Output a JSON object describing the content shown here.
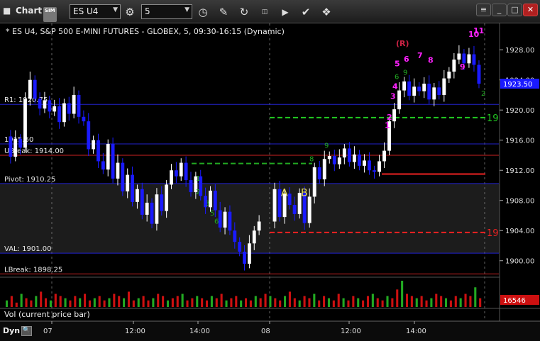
{
  "app": {
    "title": "Chart",
    "sim_badge": "SIM",
    "icon": "chart-icon"
  },
  "toolbar": {
    "symbol": "ES U4",
    "interval": "5",
    "icons": [
      "settings-gear-icon",
      "clock-icon",
      "pencil-draw-icon",
      "refresh-icon",
      "get-data-icon",
      "play-icon",
      "check-icon",
      "tools-icon"
    ],
    "window_buttons": [
      "menu-icon",
      "minimize-icon",
      "maximize-icon",
      "close-icon"
    ]
  },
  "chart_title": "* ES U4, S&P 500 E-MINI FUTURES - GLOBEX, 5, 09:30-16:15 (Dynamic)",
  "volume_label": "Vol (current price bar)",
  "bottom_left": {
    "mode": "Dyn",
    "mag_icon": "zoom-icon"
  },
  "colors": {
    "background": "#000000",
    "up_bar": "#ffffff",
    "down_bar": "#1a1aff",
    "pivot_line": "#2222cc",
    "break_line": "#cc2222",
    "green_dashed": "#22cc22",
    "red_dashed": "#ee2222",
    "value_area_fill": "#1c1c1c",
    "volume": "#cc1010",
    "price_tag": "#1a1aff",
    "volume_tag": "#cc1010",
    "sequential_magenta": "#ff22ff",
    "sequential_green": "#22aa22"
  },
  "chart_data": {
    "type": "candlestick",
    "yaxis": {
      "ticks": [
        "1928.00",
        "1924.00",
        "1920.00",
        "1916.00",
        "1912.00",
        "1908.00",
        "1904.00",
        "1900.00"
      ],
      "range": [
        1898,
        1931.5
      ]
    },
    "xaxis": {
      "ticks": [
        "07",
        "12:00",
        "14:00",
        "08",
        "12:00",
        "14:00"
      ]
    },
    "last_price": "1923.50",
    "last_volume": "16546",
    "levels": [
      {
        "label": "R1: 1920.75",
        "value": 1920.75,
        "color": "#2222cc"
      },
      {
        "label": "1915.50",
        "value": 1915.5,
        "color": "#2222cc"
      },
      {
        "label": "UBreak: 1914.00",
        "value": 1914.0,
        "color": "#cc2222"
      },
      {
        "label": "Pivot: 1910.25",
        "value": 1910.25,
        "color": "#2222cc"
      },
      {
        "label": "VAL: 1901.00",
        "value": 1901.0,
        "color": "#2222cc"
      },
      {
        "label": "LBreak: 1898.25",
        "value": 1898.25,
        "color": "#cc2222"
      }
    ],
    "dashed_levels": [
      {
        "value": 1919.0,
        "label": "19",
        "color": "#22cc22"
      },
      {
        "value": 1903.75,
        "label": "19",
        "color": "#ee2222"
      },
      {
        "value": 1912.9,
        "label": "",
        "color": "#22aa22"
      }
    ],
    "annotations": [
      "A",
      "B"
    ],
    "sequential_top_labels": [
      "(R)",
      "5",
      "6",
      "7",
      "8",
      "9",
      "10",
      "11",
      "4",
      "3",
      "2",
      "1"
    ],
    "sequential_green_labels": [
      "6",
      "9",
      "2",
      "1",
      "2",
      "3",
      "5",
      "6",
      "8",
      "9"
    ],
    "bars_day1": [
      1916.5,
      1913.8,
      1916.2,
      1915.0,
      1921.5,
      1924.0,
      1921.5,
      1920.2,
      1921.3,
      1919.8,
      1920.5,
      1918.4,
      1920.9,
      1919.5,
      1922.0,
      1919.1,
      1918.5,
      1914.8,
      1916.0,
      1913.2,
      1912.1,
      1915.5,
      1910.9,
      1913.0,
      1909.2,
      1911.4,
      1907.8,
      1909.5,
      1906.1,
      1907.7,
      1904.9,
      1908.8,
      1906.6,
      1910.1,
      1912.0,
      1911.2,
      1913.0,
      1910.7,
      1909.1,
      1911.2,
      1908.6,
      1907.1,
      1909.3,
      1906.7,
      1904.4,
      1906.5,
      1904.0,
      1902.5,
      1901.2,
      1899.6,
      1902.3,
      1904.0,
      1905.2
    ],
    "bars_day2": [
      1905.2,
      1909.5,
      1905.8,
      1908.9,
      1907.4,
      1906.2,
      1909.0,
      1905.0,
      1908.5,
      1912.4,
      1910.8,
      1913.5,
      1913.9,
      1912.8,
      1913.7,
      1914.9,
      1913.1,
      1914.1,
      1912.6,
      1913.3,
      1912.0,
      1911.8,
      1913.2,
      1914.6,
      1918.5,
      1920.1,
      1922.6,
      1923.8,
      1921.9,
      1923.1,
      1922.5,
      1923.5,
      1921.4,
      1923.0,
      1922.0,
      1924.2,
      1925.1,
      1926.7,
      1927.5,
      1926.2,
      1927.4,
      1926.0,
      1923.5
    ],
    "volume_series": [
      3,
      5,
      2,
      6,
      4,
      3,
      5,
      7,
      4,
      3,
      6,
      5,
      4,
      3,
      5,
      4,
      6,
      3,
      4,
      5,
      3,
      4,
      6,
      5,
      4,
      7,
      3,
      4,
      5,
      3,
      4,
      6,
      5,
      3,
      4,
      5,
      6,
      3,
      4,
      5,
      4,
      3,
      5,
      4,
      6,
      3,
      4,
      5,
      3,
      4,
      3,
      5,
      4,
      6,
      5,
      4,
      3,
      5,
      7,
      4,
      3,
      5,
      4,
      6,
      3,
      5,
      4,
      3,
      6,
      4,
      3,
      5,
      4,
      3,
      5,
      6,
      4,
      3,
      5,
      4,
      8,
      12,
      6,
      5,
      4,
      5,
      3,
      4,
      6,
      5,
      4,
      3,
      5,
      4,
      6,
      5,
      9,
      4
    ]
  }
}
